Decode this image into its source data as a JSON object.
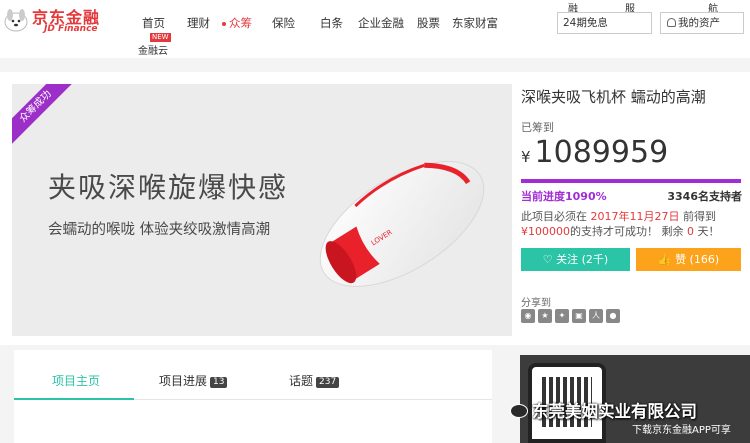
{
  "header": {
    "logo_cn": "京东金融",
    "logo_en": "JD Finance",
    "nav": [
      {
        "label": "首页"
      },
      {
        "label": "理财"
      },
      {
        "label": "众筹"
      },
      {
        "label": "保险"
      },
      {
        "label": "白条"
      },
      {
        "label": "企业金融"
      },
      {
        "label": "股票"
      },
      {
        "label": "东家财富"
      }
    ],
    "sub_nav_label": "金融云",
    "new_badge": "NEW",
    "top_fragments": [
      "融",
      "服",
      "航"
    ],
    "search_value": "24期免息",
    "my_assets": "我的资产"
  },
  "project": {
    "ribbon": "众筹成功",
    "headline": "夹吸深喉旋爆快感",
    "subline": "会蠕动的喉咙 体验夹绞吸激情高潮",
    "brand_mark": "LOVER",
    "title": "深喉夹吸飞机杯 蠕动的高潮",
    "raised_label": "已筹到",
    "currency": "¥",
    "raised_amount": "1089959",
    "progress_label": "当前进度1090%",
    "progress_fraction": 1.0,
    "backers": "3346名支持者",
    "note_a": "此项目必须在",
    "note_date": "2017年11月27日",
    "note_b": "前得到",
    "note_goal": "¥100000",
    "note_c": "的支持才可成功！ 剩余",
    "note_days": "0",
    "note_d": "天！",
    "follow_label": "关注 (2千)",
    "like_label": "赞 (166)",
    "share_label": "分享到",
    "share_icons": [
      "weibo-icon",
      "qzone-icon",
      "star-icon",
      "douban-icon",
      "renren-icon",
      "wechat-icon"
    ]
  },
  "tabs": [
    {
      "label": "项目主页",
      "count": ""
    },
    {
      "label": "项目进展",
      "count": "13"
    },
    {
      "label": "话题",
      "count": "237"
    }
  ],
  "app_promo": {
    "text": "下载京东金融APP可享"
  },
  "watermark": "东莞美姻实业有限公司",
  "colors": {
    "brand_red": "#e4393c",
    "progress_purple": "#a22dd5",
    "follow_green": "#2bc4a7",
    "like_orange": "#fda31b"
  }
}
